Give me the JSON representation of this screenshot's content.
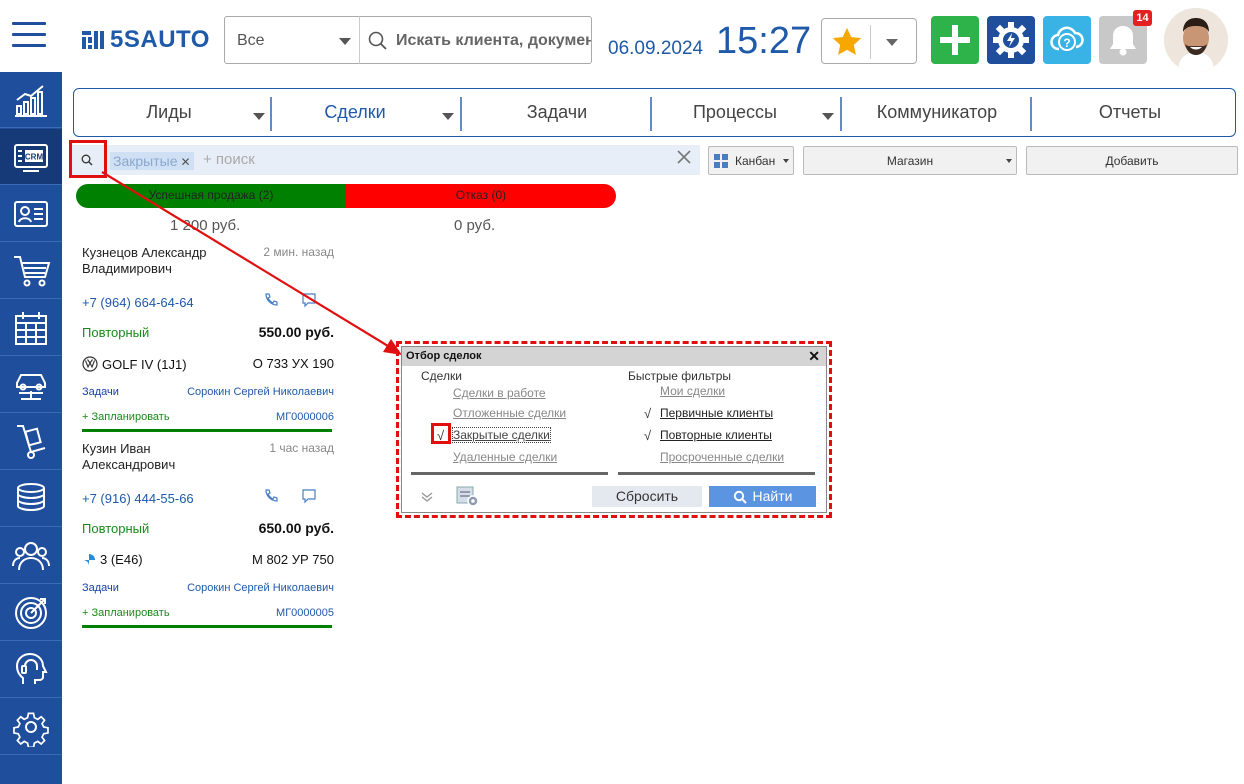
{
  "header": {
    "logo_text": "5SAUTO",
    "filter_select": "Все",
    "search_placeholder": "Искать клиента, документ",
    "date": "06.09.2024",
    "time": "15:27",
    "notification_count": "14",
    "colors": {
      "brand": "#1e5aa8",
      "add": "#2db34a",
      "settings": "#1f4e9c",
      "help": "#39b3e6",
      "bell": "#c8c8c8",
      "star": "#f7a800"
    }
  },
  "sidebar": {
    "items": [
      {
        "name": "dashboard-chart-icon"
      },
      {
        "name": "crm-icon",
        "label": "CRM",
        "active": true
      },
      {
        "name": "contact-card-icon"
      },
      {
        "name": "cart-icon"
      },
      {
        "name": "calendar-icon"
      },
      {
        "name": "car-lift-icon"
      },
      {
        "name": "dolly-icon"
      },
      {
        "name": "coins-icon"
      },
      {
        "name": "people-icon"
      },
      {
        "name": "target-icon"
      },
      {
        "name": "head-support-icon"
      },
      {
        "name": "gear-icon"
      }
    ]
  },
  "tabs": [
    {
      "label": "Лиды",
      "has_dropdown": true
    },
    {
      "label": "Сделки",
      "has_dropdown": true,
      "active": true
    },
    {
      "label": "Задачи",
      "has_dropdown": false
    },
    {
      "label": "Процессы",
      "has_dropdown": true
    },
    {
      "label": "Коммуникатор",
      "has_dropdown": false
    },
    {
      "label": "Отчеты",
      "has_dropdown": false
    }
  ],
  "filter_bar": {
    "chip": "Закрытые",
    "placeholder": "+ поиск",
    "view_label": "Канбан",
    "store_label": "Магазин",
    "add_label": "Добавить"
  },
  "status": {
    "success_label": "Успешная продажа (2)",
    "success_sum": "1 200 руб.",
    "refusal_label": "Отказ (0)",
    "refusal_sum": "0 руб."
  },
  "cards": [
    {
      "name": "Кузнецов Александр Владимирович",
      "time": "2 мин. назад",
      "phone": "+7 (964) 664-64-64",
      "type": "Повторный",
      "price": "550.00 руб.",
      "car": "GOLF IV (1J1)",
      "car_brand_icon": "vw-logo-icon",
      "plate": "О 733 УХ 190",
      "task": "Задачи",
      "responsible": "Сорокин Сергей Николаевич",
      "plan": "+ Запланировать",
      "code": "МГ0000006"
    },
    {
      "name": "Кузин Иван Александрович",
      "time": "1 час назад",
      "phone": "+7 (916) 444-55-66",
      "type": "Повторный",
      "price": "650.00 руб.",
      "car": "3 (E46)",
      "car_brand_icon": "bmw-logo-icon",
      "plate": "М 802 УР 750",
      "task": "Задачи",
      "responsible": "Сорокин Сергей Николаевич",
      "plan": "+ Запланировать",
      "code": "МГ0000005"
    }
  ],
  "popup": {
    "title": "Отбор сделок",
    "deals_header": "Сделки",
    "deals": [
      {
        "label": "Сделки в работе",
        "checked": false
      },
      {
        "label": "Отложенные сделки",
        "checked": false
      },
      {
        "label": "Закрытые сделки",
        "checked": true
      },
      {
        "label": "Удаленные сделки",
        "checked": false
      }
    ],
    "quick_header": "Быстрые фильтры",
    "quick": [
      {
        "label": "Мои сделки",
        "checked": false
      },
      {
        "label": "Первичные клиенты",
        "checked": true
      },
      {
        "label": "Повторные клиенты",
        "checked": true
      },
      {
        "label": "Просроченные сделки",
        "checked": false
      }
    ],
    "check_mark": "√",
    "reset_label": "Сбросить",
    "find_label": "Найти"
  }
}
